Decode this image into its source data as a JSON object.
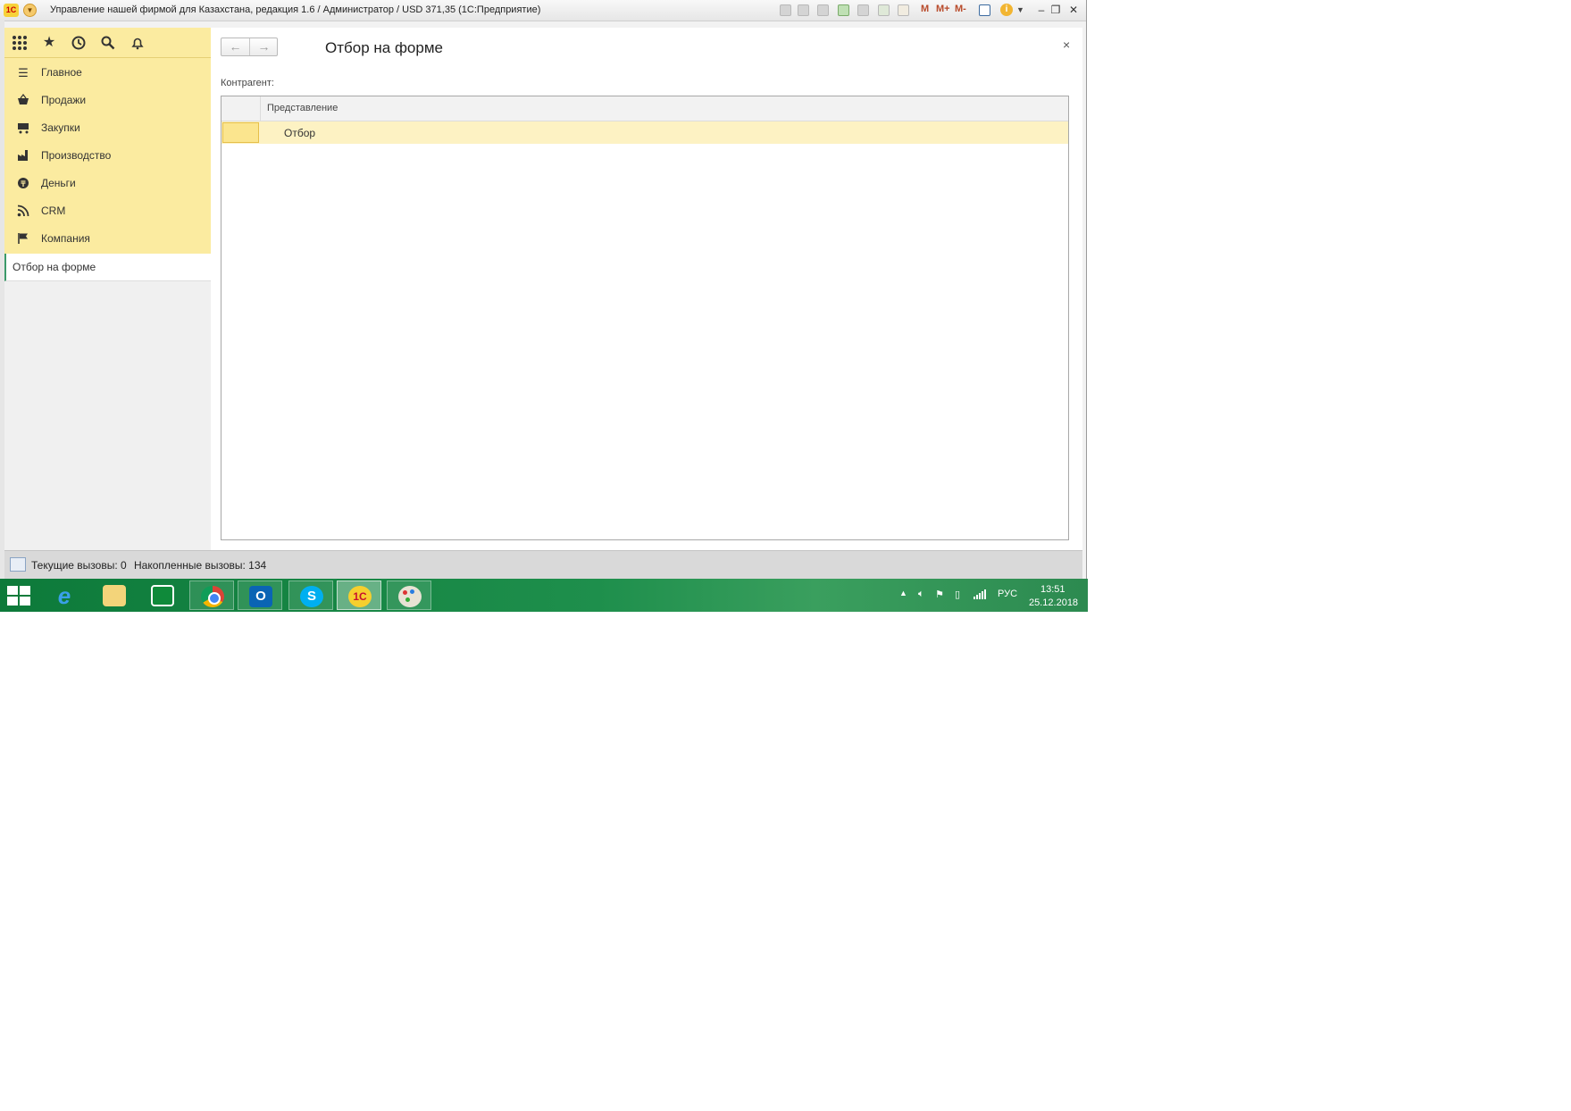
{
  "window": {
    "title": "Управление нашей фирмой для Казахстана, редакция 1.6 / Администратор / USD 371,35  (1С:Предприятие)",
    "logo_text": "1С",
    "toolbar_m": "M",
    "toolbar_mplus": "M+",
    "toolbar_mminus": "M-"
  },
  "sidebar": {
    "nav_items": [
      {
        "label": "Главное",
        "icon": "menu-lines-icon"
      },
      {
        "label": "Продажи",
        "icon": "basket-icon"
      },
      {
        "label": "Закупки",
        "icon": "cart-icon"
      },
      {
        "label": "Производство",
        "icon": "factory-icon"
      },
      {
        "label": "Деньги",
        "icon": "coin-icon"
      },
      {
        "label": "CRM",
        "icon": "rss-icon"
      },
      {
        "label": "Компания",
        "icon": "flag-icon"
      }
    ],
    "open_form": "Отбор на форме"
  },
  "form": {
    "title": "Отбор на форме",
    "field_label": "Контрагент:",
    "table": {
      "columns": [
        "Представление"
      ],
      "rows": [
        [
          "Отбор"
        ]
      ]
    }
  },
  "statusbar": {
    "current_calls_label": "Текущие вызовы:  0",
    "accumulated_calls_label": "Накопленные вызовы:  134"
  },
  "taskbar": {
    "language": "РУС",
    "time": "13:51",
    "date": "25.12.2018",
    "colors": {
      "taskbar": "#1e8f4c",
      "sidebar": "#fbeba0"
    }
  }
}
